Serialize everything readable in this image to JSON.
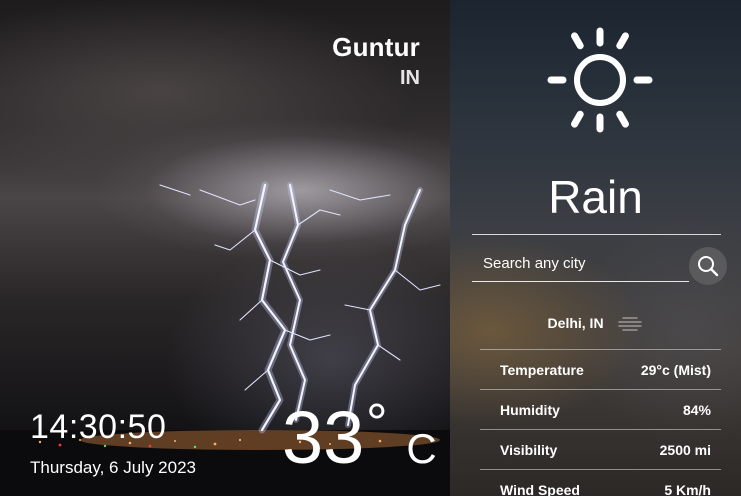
{
  "location": {
    "city": "Guntur",
    "country": "IN"
  },
  "clock": {
    "time": "14:30:50",
    "date": "Thursday, 6 July 2023"
  },
  "current": {
    "temperature": "33",
    "degree_symbol": "°",
    "unit": "C"
  },
  "panel": {
    "condition": "Rain",
    "condition_icon": "sun-icon",
    "search": {
      "placeholder": "Search any city",
      "value": "",
      "button_icon": "search-icon"
    },
    "result_location": "Delhi, IN",
    "result_icon": "mist-icon",
    "details": [
      {
        "label": "Temperature",
        "value": "29°c (Mist)"
      },
      {
        "label": "Humidity",
        "value": "84%"
      },
      {
        "label": "Visibility",
        "value": "2500 mi"
      },
      {
        "label": "Wind Speed",
        "value": "5 Km/h"
      }
    ]
  },
  "colors": {
    "search_button": "#5a5a5c",
    "text": "#ffffff",
    "divider": "#d8d8d8"
  }
}
